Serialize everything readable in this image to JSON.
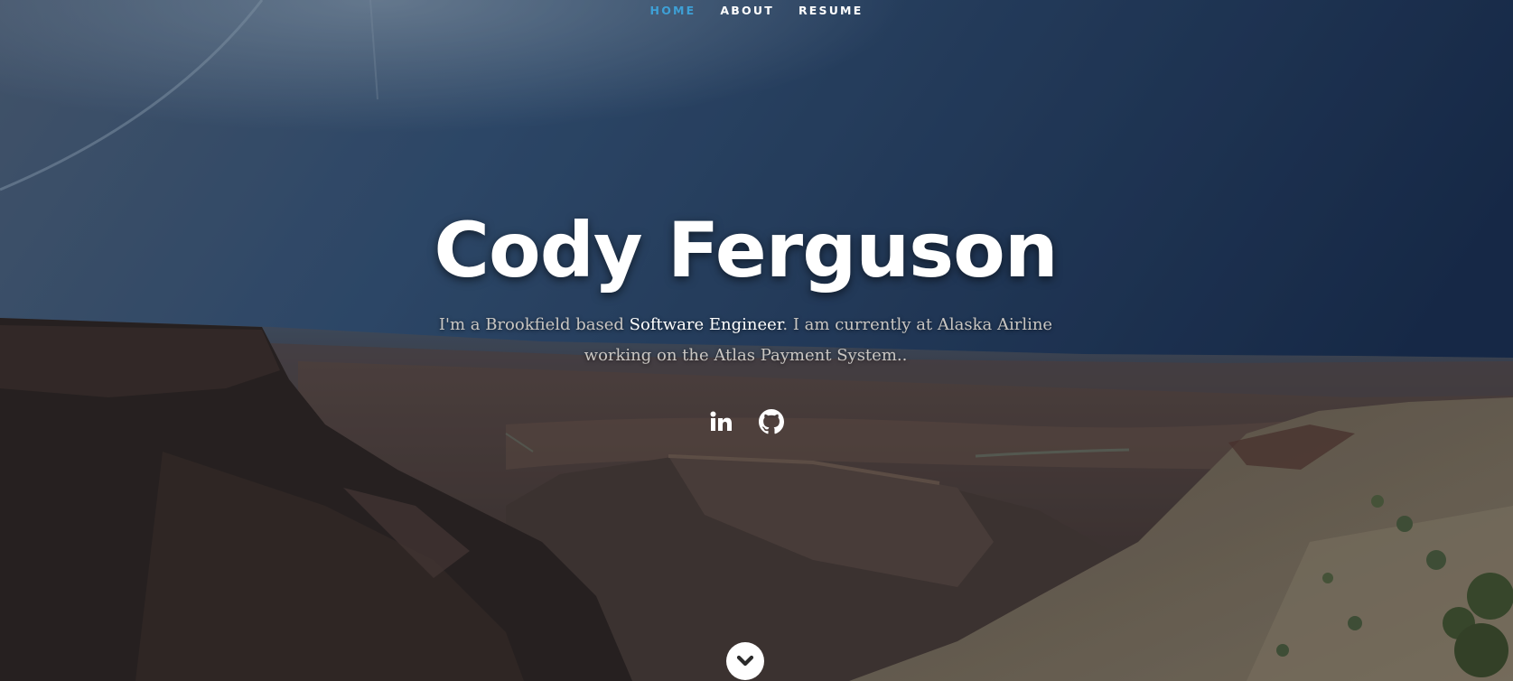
{
  "nav": {
    "items": [
      {
        "label": "HOME",
        "active": true
      },
      {
        "label": "ABOUT",
        "active": false
      },
      {
        "label": "RESUME",
        "active": false
      }
    ]
  },
  "hero": {
    "name": "Cody Ferguson",
    "intro": {
      "part1": "I'm a Brookfield based ",
      "highlight1": "Software Engineer",
      "part2": ". I am currently at Alaska Airline working on the Atlas Payment System.."
    },
    "social": [
      {
        "icon": "linkedin-icon"
      },
      {
        "icon": "github-icon"
      }
    ],
    "scroll_icon": "chevron-down-icon"
  },
  "colors": {
    "nav_active": "#3ea0d6",
    "nav_text": "#ffffff",
    "title": "#ffffff",
    "intro_text": "#c9c6c2",
    "intro_highlight": "#ffffff"
  }
}
